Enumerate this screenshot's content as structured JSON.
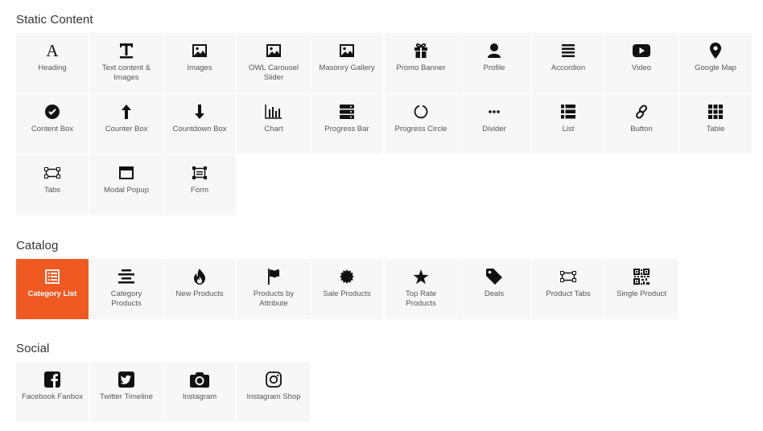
{
  "sections": [
    {
      "title": "Static Content",
      "items": [
        {
          "label": "Heading",
          "icon": "heading-icon"
        },
        {
          "label": "Text content &\nImages",
          "icon": "text-icon"
        },
        {
          "label": "Images",
          "icon": "image-icon"
        },
        {
          "label": "OWL Carousel\nSlider",
          "icon": "carousel-icon"
        },
        {
          "label": "Masonry Gallery",
          "icon": "gallery-icon"
        },
        {
          "label": "Promo Banner",
          "icon": "gift-icon"
        },
        {
          "label": "Profile",
          "icon": "user-icon"
        },
        {
          "label": "Accordion",
          "icon": "accordion-icon"
        },
        {
          "label": "Video",
          "icon": "video-icon"
        },
        {
          "label": "Google Map",
          "icon": "map-marker-icon"
        },
        {
          "label": "Content Box",
          "icon": "check-circle-icon"
        },
        {
          "label": "Counter Box",
          "icon": "arrow-up-icon"
        },
        {
          "label": "Countdown Box",
          "icon": "arrow-down-icon"
        },
        {
          "label": "Chart",
          "icon": "bar-chart-icon"
        },
        {
          "label": "Progress Bar",
          "icon": "server-icon"
        },
        {
          "label": "Progress Circle",
          "icon": "circle-notch-icon"
        },
        {
          "label": "Divider",
          "icon": "ellipsis-icon"
        },
        {
          "label": "List",
          "icon": "list-icon"
        },
        {
          "label": "Button",
          "icon": "link-icon"
        },
        {
          "label": "Table",
          "icon": "table-grid-icon"
        },
        {
          "label": "Tabs",
          "icon": "tabs-icon"
        },
        {
          "label": "Modal Popup",
          "icon": "window-icon"
        },
        {
          "label": "Form",
          "icon": "form-icon"
        }
      ]
    },
    {
      "title": "Catalog",
      "items": [
        {
          "label": "Category List",
          "icon": "category-list-icon",
          "active": true
        },
        {
          "label": "Category\nProducts",
          "icon": "align-center-icon"
        },
        {
          "label": "New Products",
          "icon": "fire-icon"
        },
        {
          "label": "Products by\nAttribute",
          "icon": "flag-icon"
        },
        {
          "label": "Sale Products",
          "icon": "certificate-icon"
        },
        {
          "label": "Top Rate\nProducts",
          "icon": "star-icon"
        },
        {
          "label": "Deals",
          "icon": "tag-icon"
        },
        {
          "label": "Product Tabs",
          "icon": "tabs-icon"
        },
        {
          "label": "Single Product",
          "icon": "qrcode-icon"
        }
      ]
    },
    {
      "title": "Social",
      "items": [
        {
          "label": "Facebook Fanbox",
          "icon": "facebook-icon"
        },
        {
          "label": "Twitter Timeline",
          "icon": "twitter-icon"
        },
        {
          "label": "Instagram",
          "icon": "camera-icon"
        },
        {
          "label": "Instagram Shop",
          "icon": "instagram-icon"
        }
      ]
    }
  ],
  "colors": {
    "accent": "#f05a22",
    "tile_background": "#f7f7f7",
    "icon": "#111111"
  }
}
